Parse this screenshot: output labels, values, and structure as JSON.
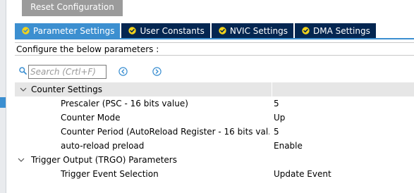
{
  "toolbar": {
    "reset_label": "Reset Configuration"
  },
  "tabs": [
    {
      "label": "Parameter Settings",
      "active": true
    },
    {
      "label": "User Constants",
      "active": false
    },
    {
      "label": "NVIC Settings",
      "active": false
    },
    {
      "label": "DMA Settings",
      "active": false
    }
  ],
  "configure": {
    "text": "Configure the below parameters :"
  },
  "search": {
    "placeholder": "Search (Crtl+F)",
    "value": ""
  },
  "groups": [
    {
      "label": "Counter Settings",
      "expanded": true,
      "params": [
        {
          "label": "Prescaler (PSC - 16 bits value)",
          "value": "5"
        },
        {
          "label": "Counter Mode",
          "value": "Up"
        },
        {
          "label": "Counter Period (AutoReload Register - 16 bits val...",
          "value": "5"
        },
        {
          "label": "auto-reload preload",
          "value": "Enable"
        }
      ]
    },
    {
      "label": "Trigger Output (TRGO) Parameters",
      "expanded": true,
      "params": [
        {
          "label": "Trigger Event Selection",
          "value": "Update Event"
        }
      ]
    }
  ],
  "colors": {
    "tab_active": "#3c8fd0",
    "tab_inactive": "#042651",
    "reset_button": "#9b9b9b",
    "group_row": "#e6e6e6",
    "accent_icon": "#3b8fd1"
  },
  "icons": {
    "tab_check": "check-circle-icon",
    "search": "search-icon",
    "prev": "previous-icon",
    "next": "next-icon",
    "expand": "chevron-down-icon"
  }
}
